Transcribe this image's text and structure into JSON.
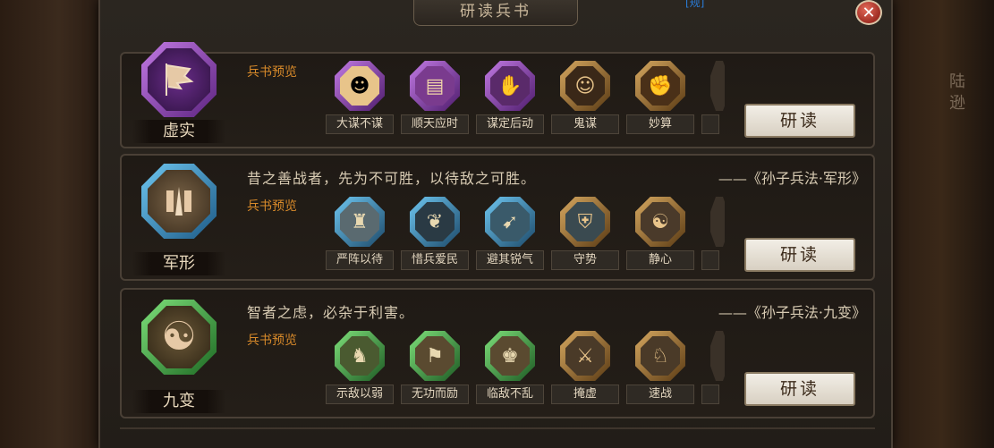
{
  "dialog": {
    "title": "研读兵书",
    "close_label": "✕",
    "top_fragment": "[规]"
  },
  "side": {
    "text": "陆逊"
  },
  "colors": {
    "purple": "#9b4fc2",
    "blue": "#3ea0d8",
    "green": "#3fb54a",
    "accent_orange": "#d88a2a"
  },
  "rows": [
    {
      "name": "虚实",
      "emblem_icon": "tattered-flag-icon",
      "preview_label": "兵书预览",
      "skills": [
        {
          "label": "大谋不谋",
          "icon": "sage-icon"
        },
        {
          "label": "顺天应时",
          "icon": "scroll-icon"
        },
        {
          "label": "谋定后动",
          "icon": "strategist-icon"
        },
        {
          "label": "鬼谋",
          "icon": "ghost-advisor-icon"
        },
        {
          "label": "妙算",
          "icon": "abacus-icon"
        }
      ],
      "button": "研读"
    },
    {
      "name": "军形",
      "emblem_icon": "formation-icon",
      "quote": "昔之善战者，先为不可胜，以待敌之可胜。",
      "source": "——《孙子兵法·军形》",
      "preview_label": "兵书预览",
      "skills": [
        {
          "label": "严阵以待",
          "icon": "troops-icon"
        },
        {
          "label": "惜兵爱民",
          "icon": "sprout-icon"
        },
        {
          "label": "避其锐气",
          "icon": "dodge-icon"
        },
        {
          "label": "守势",
          "icon": "shield-icon"
        },
        {
          "label": "静心",
          "icon": "meditation-icon"
        }
      ],
      "button": "研读"
    },
    {
      "name": "九变",
      "emblem_icon": "yin-yang-icon",
      "quote": "智者之虑，必杂于利害。",
      "source": "——《孙子兵法·九变》",
      "preview_label": "兵书预览",
      "skills": [
        {
          "label": "示敌以弱",
          "icon": "kneeling-soldier-icon"
        },
        {
          "label": "无功而励",
          "icon": "banner-soldier-icon"
        },
        {
          "label": "临敌不乱",
          "icon": "general-icon"
        },
        {
          "label": "掩虚",
          "icon": "charge-icon"
        },
        {
          "label": "速战",
          "icon": "cavalry-icon"
        }
      ],
      "button": "研读"
    }
  ]
}
